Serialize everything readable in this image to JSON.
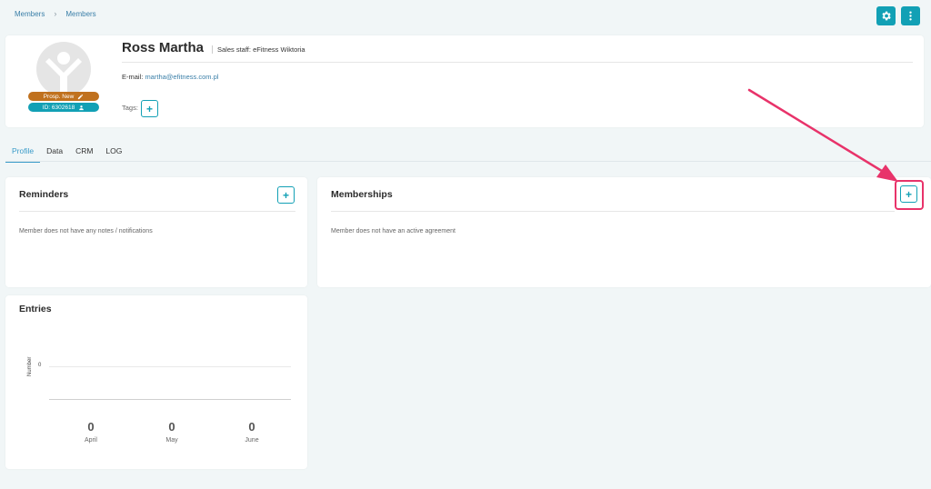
{
  "breadcrumb": [
    "Members",
    "Members"
  ],
  "toolbar": {
    "settings_icon": "gear-icon",
    "menu_icon": "more-vertical-icon"
  },
  "profile": {
    "name": "Ross Martha",
    "sales_staff_label": "Sales staff:",
    "sales_staff_value": "eFitness Wiktoria",
    "email_label": "E-mail:",
    "email_value": "martha@efitness.com.pl",
    "tags_label": "Tags:",
    "status_badge": "Prosp. New",
    "id_badge": "ID: 6302618",
    "status_color": "#c0711e",
    "id_color": "#12a0b5"
  },
  "tabs": [
    "Profile",
    "Data",
    "CRM",
    "LOG"
  ],
  "reminders": {
    "title": "Reminders",
    "empty_text": "Member does not have any notes / notifications"
  },
  "memberships": {
    "title": "Memberships",
    "empty_text": "Member does not have an active agreement"
  },
  "entries": {
    "title": "Entries"
  },
  "chart_data": {
    "type": "bar",
    "categories": [
      "April",
      "May",
      "June"
    ],
    "values": [
      0,
      0,
      0
    ],
    "ylabel": "Number",
    "yticks": [
      "0"
    ]
  },
  "colors": {
    "accent": "#12a0b5",
    "annotation": "#e8336a"
  }
}
